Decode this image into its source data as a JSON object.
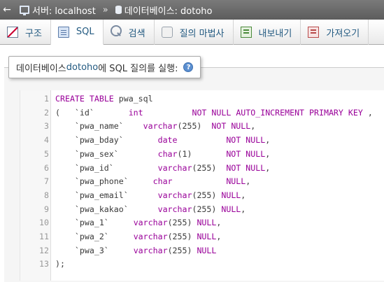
{
  "breadcrumb": {
    "back_arrow": "←",
    "server_label": "서버: localhost",
    "separator": "»",
    "database_label": "데이터베이스: dotoho",
    "server_icon": "server-icon",
    "database_icon": "database-icon"
  },
  "tabs": [
    {
      "label": "구조",
      "icon": "structure-icon",
      "active": false
    },
    {
      "label": "SQL",
      "icon": "sql-icon",
      "active": true
    },
    {
      "label": "검색",
      "icon": "search-icon",
      "active": false
    },
    {
      "label": "질의 마법사",
      "icon": "query-icon",
      "active": false
    },
    {
      "label": "내보내기",
      "icon": "export-icon",
      "active": false
    },
    {
      "label": "가져오기",
      "icon": "import-icon",
      "active": false
    }
  ],
  "legend": {
    "prefix": "데이터베이스 ",
    "database": "dotoho",
    "suffix": "에 SQL 질의를 실행:",
    "help_icon": "help-icon"
  },
  "editor": {
    "lines": [
      {
        "num": "1",
        "text": "CREATE TABLE pwa_sql"
      },
      {
        "num": "2",
        "text": "(   `id`       int          NOT NULL AUTO_INCREMENT PRIMARY KEY ,"
      },
      {
        "num": "3",
        "text": "    `pwa_name`    varchar(255)  NOT NULL,"
      },
      {
        "num": "4",
        "text": "    `pwa_bday`       date          NOT NULL,"
      },
      {
        "num": "5",
        "text": "    `pwa_sex`        char(1)       NOT NULL,"
      },
      {
        "num": "6",
        "text": "    `pwa_id`         varchar(255)  NOT NULL,"
      },
      {
        "num": "7",
        "text": "    `pwa_phone`     char           NULL,"
      },
      {
        "num": "8",
        "text": "    `pwa_email`      varchar(255) NULL,"
      },
      {
        "num": "9",
        "text": "    `pwa_kakao`      varchar(255) NULL,"
      },
      {
        "num": "10",
        "text": "    `pwa_1`     varchar(255) NULL,"
      },
      {
        "num": "11",
        "text": "    `pwa_2`     varchar(255) NULL,"
      },
      {
        "num": "12",
        "text": "    `pwa_3`     varchar(255) NULL"
      },
      {
        "num": "13",
        "text": ");"
      }
    ]
  },
  "colors": {
    "keyword": "#990099",
    "link": "#235a81",
    "crumbbar": "#6b6b6b"
  }
}
